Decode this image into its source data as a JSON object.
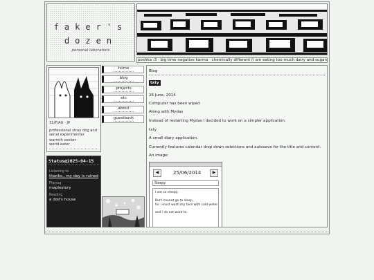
{
  "logo": {
    "line1": "faker's",
    "line2": "dozen",
    "tagline": "personal laboratoris"
  },
  "ticker": {
    "text": "poshka :3 ·  big time negative karma ·  chemically different (i am eating too much dairy and sugars) ·  mij"
  },
  "profile": {
    "handle": "31/F/AU · JP",
    "bio1": "professional stray dog and",
    "bio2": "serial experimenter",
    "trait1": "warmth seeker",
    "trait2": "world eater"
  },
  "nav": {
    "items": [
      {
        "label": "home"
      },
      {
        "label": "blog"
      },
      {
        "label": "projects"
      },
      {
        "label": "etc"
      },
      {
        "label": "about"
      },
      {
        "label": "guestbook"
      }
    ]
  },
  "status": {
    "title": "Status@2025-04-15",
    "listening_label": "Listening to",
    "listening_value": "thanks., my day is ruined",
    "playing_label": "Playing",
    "playing_value": "maplestory",
    "reading_label": "Reading",
    "reading_value": "a doll's house"
  },
  "main": {
    "breadcrumb": "Blog",
    "tag": "txty",
    "date": "26 June, 2014",
    "p1": "Computer has been wiped",
    "p2": "Along with Mydas",
    "p3": "Instead of restarting Mydas I decided to work on a simpler application",
    "p4": "txty",
    "p5": "A small diary application.",
    "p6": "Currently features calendar drop down selections and autosave for the title and content.",
    "p7": "An image:",
    "app": {
      "date": "25/06/2014",
      "title_value": "Sleepy",
      "line1": "I am so sleepy.",
      "line2": "But i cannot go to sleep,",
      "line3": "for i must wash my face with cold water",
      "line4": "and i do not want to"
    }
  }
}
